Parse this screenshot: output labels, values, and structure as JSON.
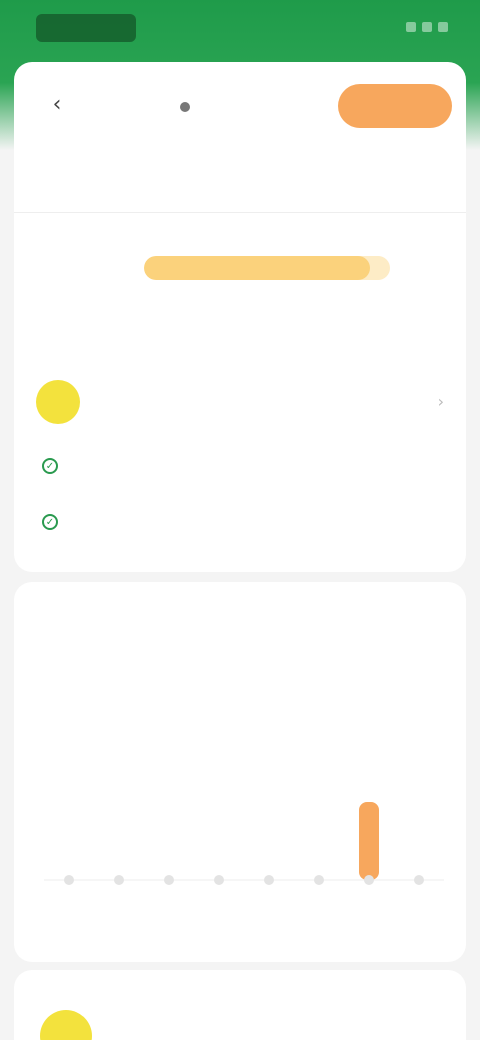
{
  "header": {
    "title": "",
    "action_label": ""
  },
  "summary": {
    "big_label": "",
    "big_value": "",
    "row_label": "",
    "progress_fraction": 0.92,
    "description": ""
  },
  "notice": {
    "text": ""
  },
  "checks": [
    {
      "text": ""
    },
    {
      "text": ""
    }
  ],
  "chart_section": {
    "title": "",
    "tabs": [
      "",
      "",
      "",
      ""
    ],
    "sub_note": "",
    "y_title": "",
    "legend_a": "",
    "legend_b": ""
  },
  "bottom": {
    "title": "",
    "text": ""
  },
  "colors": {
    "brand_green": "#2aa453",
    "accent_orange": "#f7a75d",
    "progress_yellow": "#fbd27c",
    "sun_yellow": "#f3e23d"
  },
  "chart_data": {
    "type": "bar",
    "categories": [
      "",
      "",
      "",
      "",
      "",
      "",
      "",
      ""
    ],
    "values": [
      0,
      0,
      0,
      0,
      0,
      0,
      1,
      0
    ],
    "title": "",
    "xlabel": "",
    "ylabel": "",
    "ylim": [
      0,
      1
    ]
  }
}
